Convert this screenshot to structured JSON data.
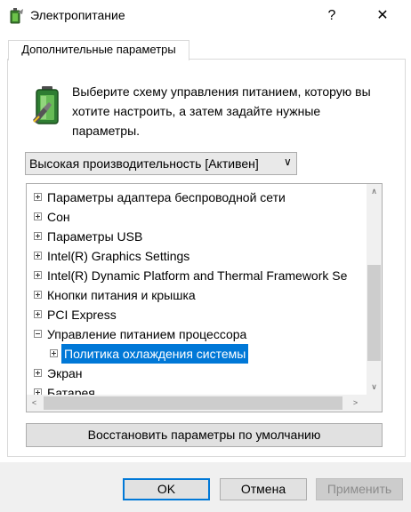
{
  "window": {
    "title": "Электропитание",
    "help_glyph": "?",
    "close_glyph": "✕",
    "icon": "power-options-icon"
  },
  "tab": {
    "label": "Дополнительные параметры"
  },
  "header": {
    "icon": "battery-icon",
    "description": "Выберите схему управления питанием, которую вы хотите настроить, а затем задайте нужные параметры."
  },
  "scheme_select": {
    "value": "Высокая производительность [Активен]",
    "chevron": "∨"
  },
  "tree": {
    "items": [
      {
        "label": "Параметры адаптера беспроводной сети",
        "expanded": false
      },
      {
        "label": "Сон",
        "expanded": false
      },
      {
        "label": "Параметры USB",
        "expanded": false
      },
      {
        "label": "Intel(R) Graphics Settings",
        "expanded": false
      },
      {
        "label": "Intel(R) Dynamic Platform and Thermal Framework Se",
        "expanded": false
      },
      {
        "label": "Кнопки питания и крышка",
        "expanded": false
      },
      {
        "label": "PCI Express",
        "expanded": false
      },
      {
        "label": "Управление питанием процессора",
        "expanded": true
      },
      {
        "label": "Политика охлаждения системы",
        "expanded": false,
        "selected": true,
        "child": true
      },
      {
        "label": "Экран",
        "expanded": false
      },
      {
        "label": "Батарея",
        "expanded": false
      }
    ],
    "scroll_up": "∧",
    "scroll_down": "∨",
    "scroll_left": "<",
    "scroll_right": ">"
  },
  "restore_button": {
    "label": "Восстановить параметры по умолчанию"
  },
  "footer": {
    "ok": "OK",
    "cancel": "Отмена",
    "apply": "Применить"
  },
  "colors": {
    "selection": "#0078d7",
    "default_button_border": "#0078d7",
    "footer_bg": "#f0f0f0"
  }
}
